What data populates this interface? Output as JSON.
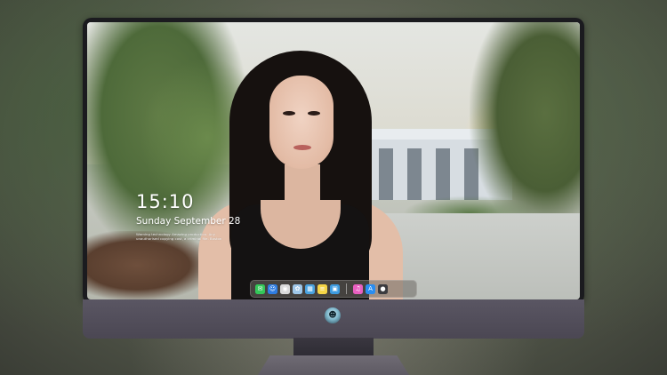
{
  "lock_screen": {
    "time": "15:10",
    "date": "Sunday September 28",
    "notice_line1": "Warning technology Amazing production. Any",
    "notice_line2": "unauthorised copying cost, a criminal file. Boston"
  },
  "dock": {
    "items": [
      {
        "name": "messages-icon",
        "glyph": "✉",
        "color": "#34c759"
      },
      {
        "name": "finder-icon",
        "glyph": "☺",
        "color": "#2f7de1"
      },
      {
        "name": "safari-icon",
        "glyph": "◉",
        "color": "#d9d9d9"
      },
      {
        "name": "photos-icon",
        "glyph": "✿",
        "color": "#9fc7e8"
      },
      {
        "name": "clapper-icon",
        "glyph": "▦",
        "color": "#4aa3df"
      },
      {
        "name": "notes-icon",
        "glyph": "≡",
        "color": "#f5d547"
      },
      {
        "name": "preview-icon",
        "glyph": "▣",
        "color": "#3d9be0"
      }
    ],
    "items_right": [
      {
        "name": "music-icon",
        "glyph": "♫",
        "color": "#e85fc0"
      },
      {
        "name": "app-store-icon",
        "glyph": "A",
        "color": "#2a8df0"
      },
      {
        "name": "camera-icon",
        "glyph": "●",
        "color": "#3b3b3f"
      }
    ]
  },
  "monitor": {
    "logo_icon": "avatar-logo-icon"
  }
}
